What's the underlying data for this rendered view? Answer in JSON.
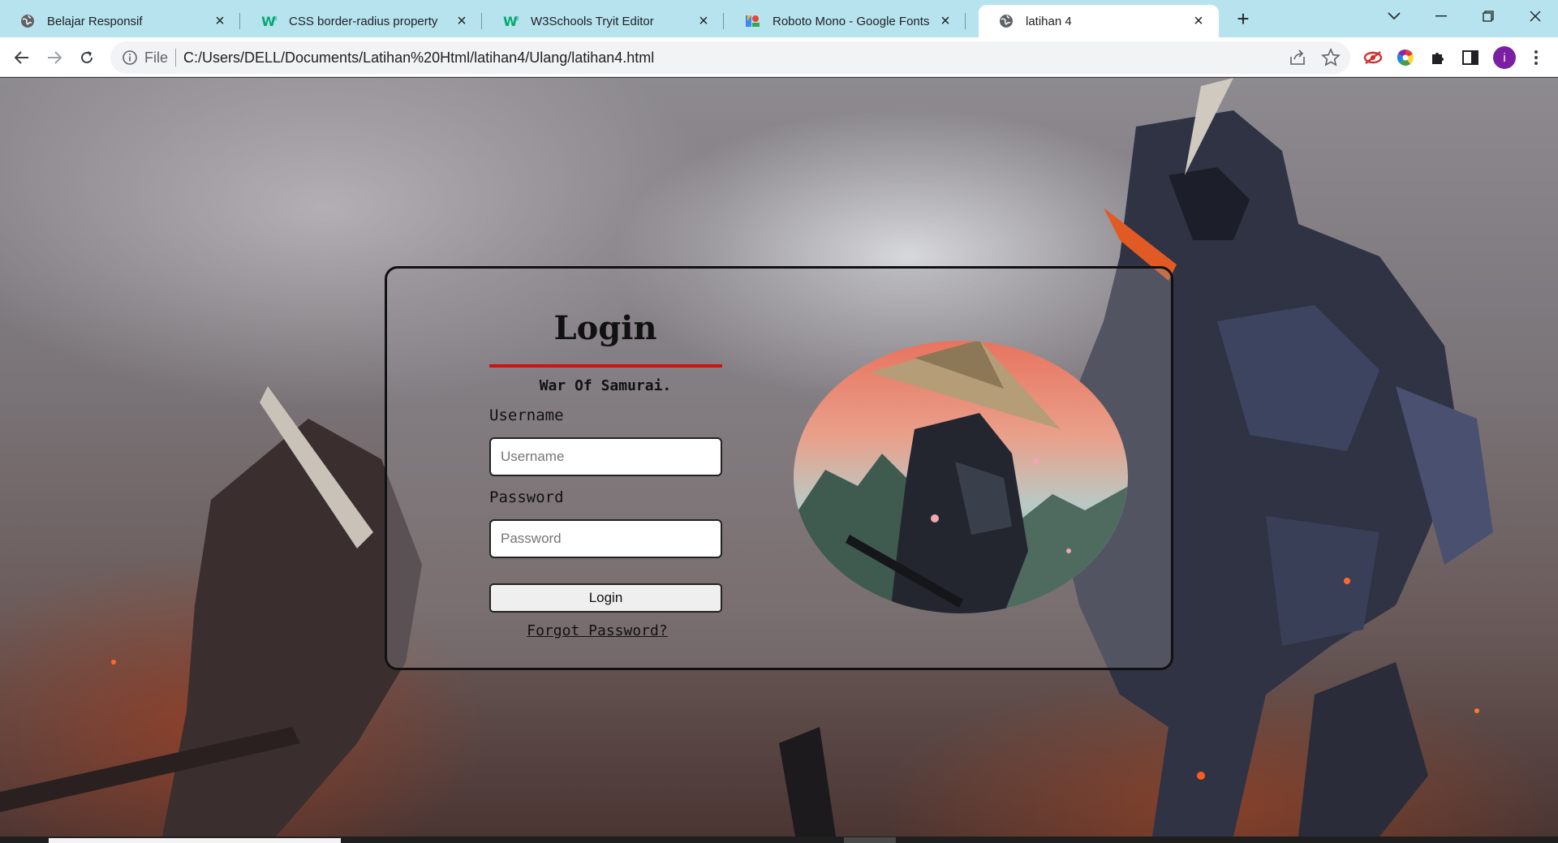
{
  "browser": {
    "tabs": [
      {
        "title": "Belajar Responsif",
        "icon": "globe-icon",
        "active": false
      },
      {
        "title": "CSS border-radius property",
        "icon": "w3schools-icon",
        "active": false
      },
      {
        "title": "W3Schools Tryit Editor",
        "icon": "w3schools-icon",
        "active": false
      },
      {
        "title": "Roboto Mono - Google Fonts",
        "icon": "google-fonts-icon",
        "active": false
      },
      {
        "title": "latihan 4",
        "icon": "globe-icon",
        "active": true
      }
    ],
    "omnibox": {
      "scheme_label": "File",
      "url": "C:/Users/DELL/Documents/Latihan%20Html/latihan4/Ulang/latihan4.html"
    },
    "profile_initial": "i",
    "colors": {
      "tabstrip": "#b7e3ee",
      "profile": "#7b1fa2"
    }
  },
  "page": {
    "login": {
      "title": "Login",
      "subtitle": "War Of Samurai.",
      "username_label": "Username",
      "username_placeholder": "Username",
      "password_label": "Password",
      "password_placeholder": "Password",
      "submit_label": "Login",
      "forgot_label": "Forgot Password?"
    },
    "colors": {
      "accent_underline": "#d11010",
      "card_border": "#111111"
    }
  }
}
